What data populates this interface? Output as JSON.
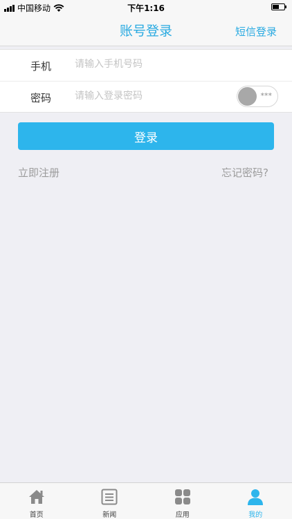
{
  "status_bar": {
    "carrier": "中国移动",
    "time": "下午1:16"
  },
  "nav": {
    "title": "账号登录",
    "right_action": "短信登录"
  },
  "form": {
    "phone_label": "手机",
    "phone_placeholder": "请输入手机号码",
    "password_label": "密码",
    "password_placeholder": "请输入登录密码",
    "password_toggle_text": "***"
  },
  "login_button": "登录",
  "register_link": "立即注册",
  "forgot_link": "忘记密码?",
  "tabs": [
    {
      "label": "首页",
      "icon": "home-icon"
    },
    {
      "label": "新闻",
      "icon": "news-icon"
    },
    {
      "label": "应用",
      "icon": "apps-icon"
    },
    {
      "label": "我的",
      "icon": "user-icon",
      "active": true
    }
  ],
  "colors": {
    "accent": "#2db5ec",
    "title": "#29aae1",
    "muted": "#9b9b9b"
  }
}
